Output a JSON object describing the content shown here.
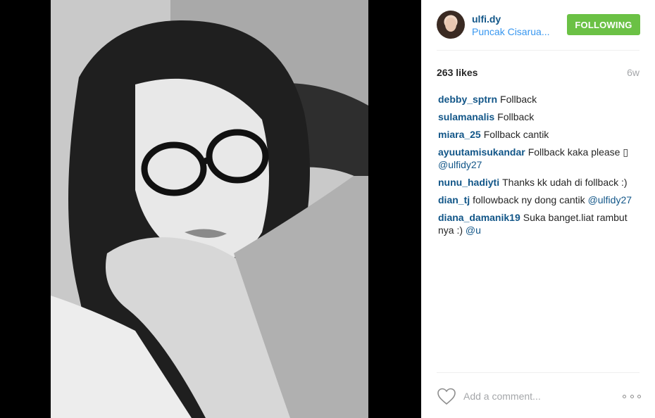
{
  "post": {
    "photo_alt": "",
    "username": "ulfi.dy",
    "location": "Puncak Cisarua...",
    "follow_label": "FOLLOWING",
    "likes": "263 likes",
    "age": "6w",
    "comments": [
      {
        "user": "debby_sptrn",
        "text": "Follback",
        "mention": ""
      },
      {
        "user": "sulamanalis",
        "text": "Follback",
        "mention": ""
      },
      {
        "user": "miara_25",
        "text": "Follback cantik",
        "mention": ""
      },
      {
        "user": "ayuutamisukandar",
        "text": "Follback kaka please ▯",
        "mention": "@ulfidy27"
      },
      {
        "user": "nunu_hadiyti",
        "text": "Thanks kk udah di follback :)",
        "mention": ""
      },
      {
        "user": "dian_tj",
        "text": "followback ny dong cantik",
        "mention": "@ulfidy27"
      },
      {
        "user": "diana_damanik19",
        "text": "Suka banget.liat rambut nya :)",
        "mention": "@u"
      }
    ],
    "comment_placeholder": "Add a comment..."
  },
  "colors": {
    "link": "#125688",
    "location": "#3897f0",
    "follow_bg": "#6bc145",
    "muted": "#a5a7aa"
  },
  "icons": {
    "like": "heart-icon",
    "more": "more-options-icon"
  }
}
